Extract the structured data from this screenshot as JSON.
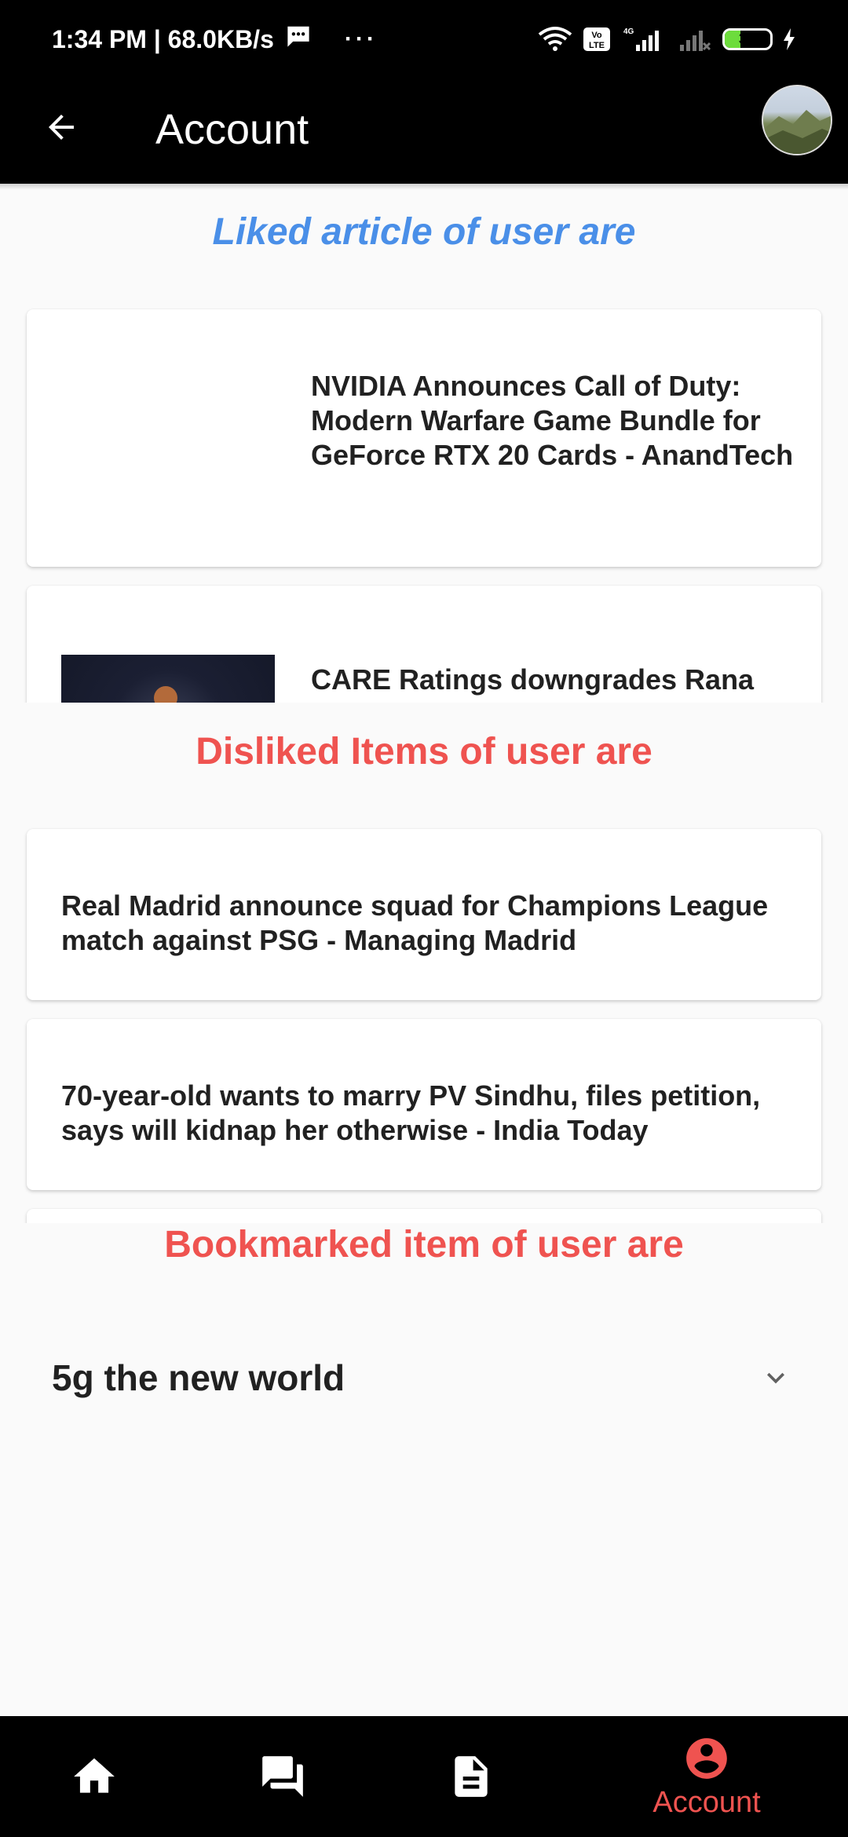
{
  "status_bar": {
    "time_speed": "1:34 PM | 68.0KB/s",
    "more": "···",
    "battery_level": "34",
    "network_lte": "Vo LTE",
    "network_4g": "4G"
  },
  "app_bar": {
    "title": "Account"
  },
  "liked": {
    "heading": "Liked article of user are",
    "items": [
      {
        "title": "NVIDIA Announces Call of Duty: Modern Warfare Game Bundle for GeForce RTX 20 Cards - AnandTech"
      },
      {
        "title": "CARE Ratings downgrades Rana"
      }
    ]
  },
  "disliked": {
    "heading": "Disliked Items of user are",
    "items": [
      {
        "title": "Real Madrid announce squad for Champions League match against PSG - Managing Madrid"
      },
      {
        "title": "70-year-old wants to marry PV Sindhu, files petition, says will kidnap her otherwise - India Today"
      }
    ]
  },
  "bookmarked": {
    "heading": "Bookmarked item of user are",
    "items": [
      {
        "title": "5g the new world"
      }
    ]
  },
  "bottom_nav": {
    "items": [
      {
        "icon": "home-icon",
        "label": ""
      },
      {
        "icon": "forum-icon",
        "label": ""
      },
      {
        "icon": "document-icon",
        "label": ""
      },
      {
        "icon": "account-circle-icon",
        "label": "Account"
      }
    ],
    "active_color": "#ef5350"
  },
  "colors": {
    "liked_heading": "#4a8fe8",
    "disliked_heading": "#ef5350",
    "bookmark_heading": "#ef5350",
    "app_bar": "#000000"
  }
}
